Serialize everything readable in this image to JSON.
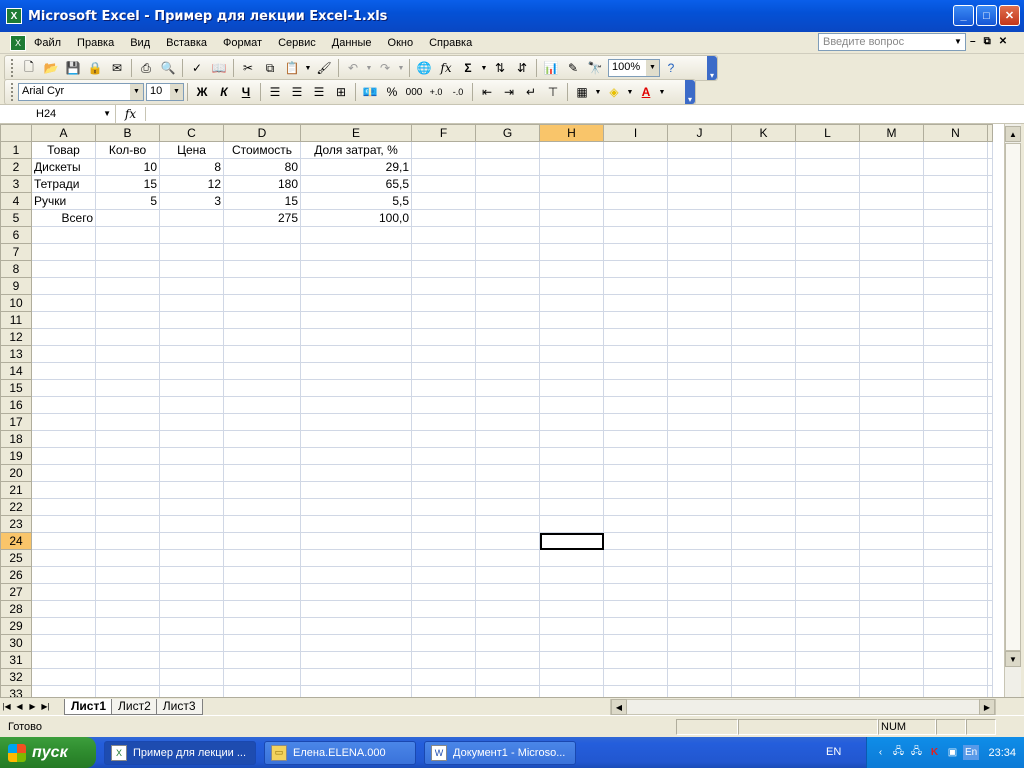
{
  "window": {
    "title": "Microsoft Excel - Пример для лекции Excel-1.xls",
    "buttons": [
      "_",
      "□",
      "✕"
    ]
  },
  "menu": {
    "items": [
      "Файл",
      "Правка",
      "Вид",
      "Вставка",
      "Формат",
      "Сервис",
      "Данные",
      "Окно",
      "Справка"
    ],
    "help_placeholder": "Введите вопрос",
    "doc_controls": [
      "–",
      "⧉",
      "✕"
    ]
  },
  "standard_toolbar": {
    "zoom": "100%"
  },
  "format_toolbar": {
    "font": "Arial Cyr",
    "size": "10",
    "bold": "Ж",
    "italic": "К",
    "underline": "Ч",
    "percent": "%",
    "thousands": "000"
  },
  "formula_bar": {
    "name_box": "H24",
    "fx": "fx",
    "formula": ""
  },
  "sheet": {
    "columns": [
      "A",
      "B",
      "C",
      "D",
      "E",
      "F",
      "G",
      "H",
      "I",
      "J",
      "K",
      "L",
      "M",
      "N"
    ],
    "selected_column": "H",
    "selected_row": 24,
    "row_count": 33,
    "rows": [
      [
        "Товар",
        "Кол-во",
        "Цена",
        "Стоимость",
        "Доля затрат, %"
      ],
      [
        "Дискеты",
        "10",
        "8",
        "80",
        "29,1"
      ],
      [
        "Тетради",
        "15",
        "12",
        "180",
        "65,5"
      ],
      [
        "Ручки",
        "5",
        "3",
        "15",
        "5,5"
      ],
      [
        "Всего",
        "",
        "",
        "275",
        "100,0"
      ]
    ]
  },
  "sheet_tabs": {
    "tabs": [
      "Лист1",
      "Лист2",
      "Лист3"
    ],
    "active": "Лист1"
  },
  "status_bar": {
    "text": "Готово",
    "num": "NUM"
  },
  "taskbar": {
    "start_label": "пуск",
    "tasks": [
      "Пример для лекции ...",
      "Елена.ELENA.000",
      "Документ1 - Microso..."
    ],
    "language": "EN",
    "tray_lang": "En",
    "clock": "23:34"
  },
  "colors": {
    "title_blue": "#0451D6",
    "selection_header": "#F9C56A",
    "taskbar_blue": "#245EDC",
    "start_green": "#2E8B2E"
  }
}
